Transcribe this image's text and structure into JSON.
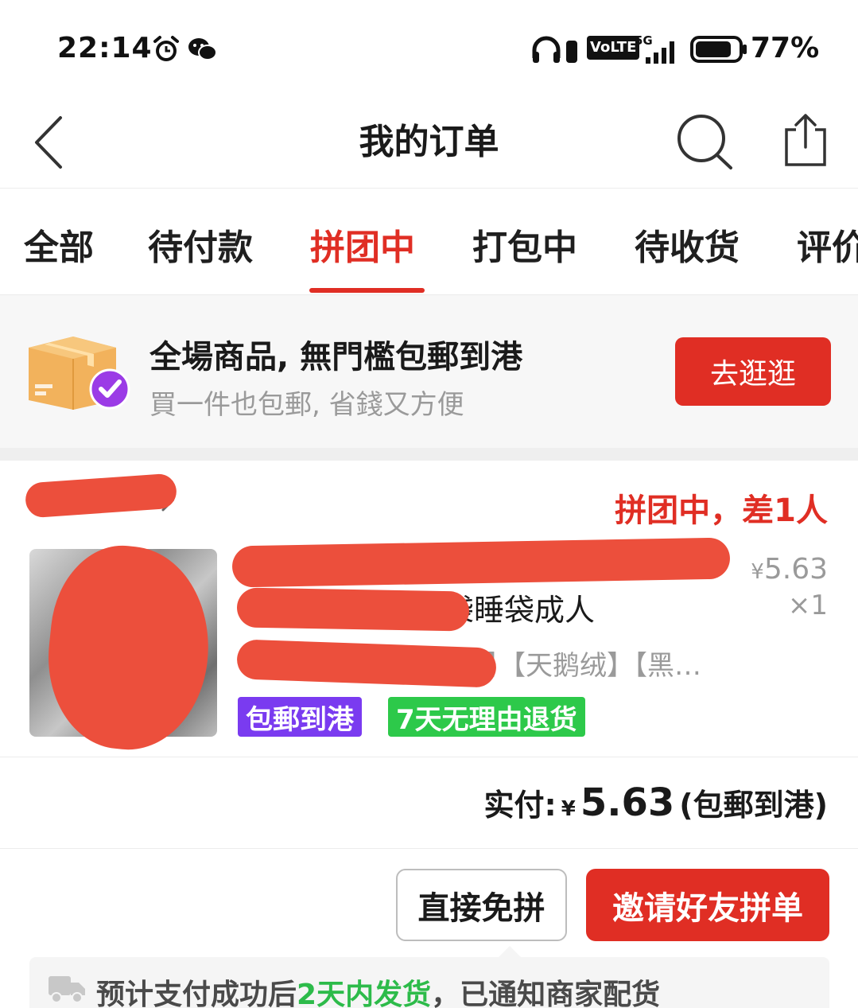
{
  "status_bar": {
    "time": "22:14",
    "network": "5G",
    "volte": "VoLTE",
    "battery": "77%",
    "icons": [
      "alarm-icon",
      "wechat-icon",
      "headphones-icon",
      "signal-icon",
      "battery-icon"
    ]
  },
  "header": {
    "title": "我的订单",
    "icons": [
      "back-icon",
      "search-icon",
      "share-icon"
    ]
  },
  "tabs": [
    {
      "label": "全部",
      "active": false
    },
    {
      "label": "待付款",
      "active": false
    },
    {
      "label": "拼团中",
      "active": true
    },
    {
      "label": "打包中",
      "active": false
    },
    {
      "label": "待收货",
      "active": false
    },
    {
      "label": "评价",
      "active": false
    }
  ],
  "promo": {
    "title": "全場商品, 無門檻包郵到港",
    "subtitle": "買一件也包郵, 省錢又方便",
    "button": "去逛逛",
    "icon": "package-check-icon"
  },
  "order": {
    "status": "拼团中，差1人",
    "product": {
      "title_line1": "",
      "title_line2": "袋睡袋成人",
      "spec": "】【天鹅绒】【黑…",
      "price_currency": "¥",
      "price": "5.63",
      "quantity": "×1",
      "tags": [
        "包郵到港",
        "7天无理由退货"
      ]
    },
    "payment": {
      "label": "实付:",
      "currency": "¥",
      "amount": "5.63",
      "note": "(包郵到港)"
    },
    "buttons": {
      "direct": "直接免拼",
      "invite": "邀请好友拼单"
    },
    "shipping": {
      "prefix": "预计支付成功后",
      "highlight": "2天内发货",
      "suffix": "，已通知商家配货"
    }
  },
  "colors": {
    "accent": "#e02e24",
    "green": "#2dc94a",
    "purple": "#7a3bf0",
    "redaction": "#ec4f3c"
  }
}
